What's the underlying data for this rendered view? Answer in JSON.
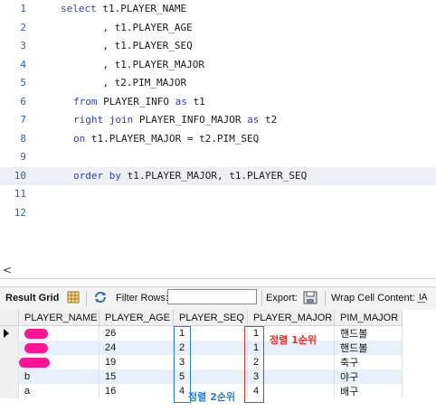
{
  "editor": {
    "lines": [
      {
        "n": "1",
        "code": [
          {
            "t": "select",
            "k": 1
          },
          {
            "t": " t1.PLAYER_NAME"
          }
        ]
      },
      {
        "n": "2",
        "code": [
          {
            "t": "       , t1.PLAYER_AGE"
          }
        ]
      },
      {
        "n": "3",
        "code": [
          {
            "t": "       , t1.PLAYER_SEQ"
          }
        ]
      },
      {
        "n": "4",
        "code": [
          {
            "t": "       , t1.PLAYER_MAJOR"
          }
        ]
      },
      {
        "n": "5",
        "code": [
          {
            "t": "       , t2.PIM_MAJOR"
          }
        ]
      },
      {
        "n": "6",
        "code": [
          {
            "t": "from",
            "k": 1
          },
          {
            "t": " PLAYER_INFO "
          },
          {
            "t": "as",
            "k": 1
          },
          {
            "t": " t1"
          }
        ]
      },
      {
        "n": "7",
        "code": [
          {
            "t": "right",
            "k": 1
          },
          {
            "t": " "
          },
          {
            "t": "join",
            "k": 1
          },
          {
            "t": " PLAYER_INFO_MAJOR "
          },
          {
            "t": "as",
            "k": 1
          },
          {
            "t": " t2"
          }
        ]
      },
      {
        "n": "8",
        "code": [
          {
            "t": "on",
            "k": 1
          },
          {
            "t": " t1.PLAYER_MAJOR = t2.PIM_SEQ"
          }
        ]
      },
      {
        "n": "9",
        "code": []
      },
      {
        "n": "10",
        "code": [
          {
            "t": "order by",
            "k": 1
          },
          {
            "t": " t1.PLAYER_MAJOR, t1.PLAYER_SEQ"
          }
        ]
      },
      {
        "n": "11",
        "code": []
      },
      {
        "n": "12",
        "code": []
      }
    ]
  },
  "scroll": {
    "arrow": "<"
  },
  "toolbar": {
    "result_grid": "Result Grid",
    "filter_rows": "Filter Rows:",
    "filter_value": "",
    "export": "Export:",
    "wrap": "Wrap Cell Content:",
    "wrap_icon": "I͟A"
  },
  "grid": {
    "columns": [
      "PLAYER_NAME",
      "PLAYER_AGE",
      "PLAYER_SEQ",
      "PLAYER_MAJOR",
      "PIM_MAJOR"
    ],
    "rows": [
      {
        "name": "",
        "age": "26",
        "seq": "1",
        "major": "1",
        "pim": "핸드볼"
      },
      {
        "name": "",
        "age": "24",
        "seq": "2",
        "major": "1",
        "pim": "핸드볼"
      },
      {
        "name": "",
        "age": "19",
        "seq": "3",
        "major": "2",
        "pim": "축구"
      },
      {
        "name": "b",
        "age": "15",
        "seq": "5",
        "major": "3",
        "pim": "야구"
      },
      {
        "name": "a",
        "age": "16",
        "seq": "4",
        "major": "4",
        "pim": "배구"
      }
    ]
  },
  "annotations": {
    "sort1": "정렬 1순위",
    "sort2": "정렬 2순위",
    "sort1_color": "#e8312a",
    "sort2_color": "#2a7fd4"
  },
  "colors": {
    "keyword": "#2f40c8",
    "line_number": "#2b5fae",
    "redaction": "#ff1493"
  }
}
